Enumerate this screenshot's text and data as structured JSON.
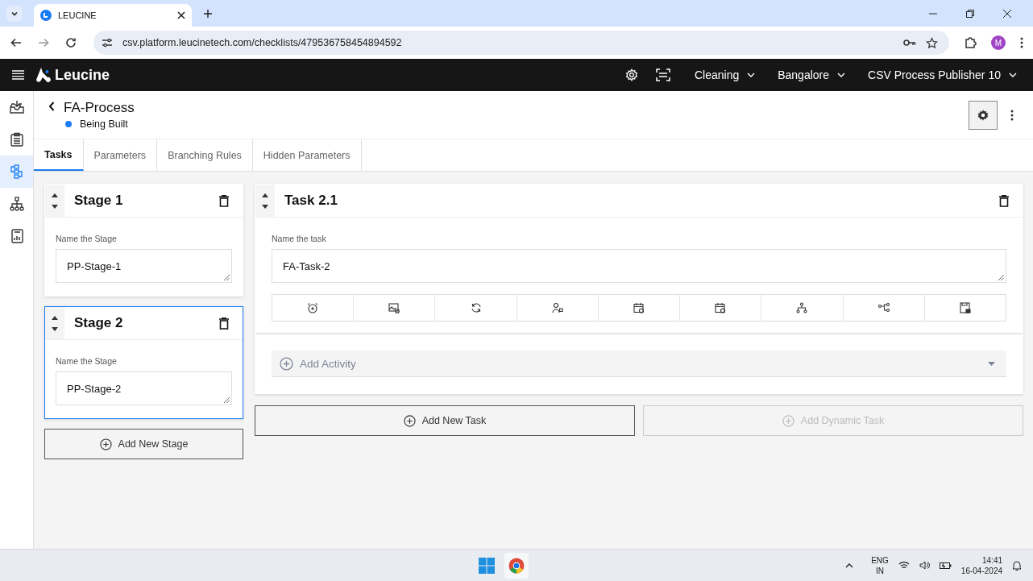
{
  "browser": {
    "tab_title": "LEUCINE",
    "url": "csv.platform.leucinetech.com/checklists/479536758454894592",
    "profile_initial": "M"
  },
  "header": {
    "brand": "Leucine",
    "selectors": [
      "Cleaning",
      "Bangalore",
      "CSV Process Publisher 10"
    ]
  },
  "sidebar": {
    "items": [
      {
        "selected": false
      },
      {
        "selected": false
      },
      {
        "selected": true
      },
      {
        "selected": false
      },
      {
        "selected": false
      }
    ]
  },
  "page": {
    "title": "FA-Process",
    "status": "Being Built"
  },
  "tabs": [
    {
      "label": "Tasks",
      "selected": true
    },
    {
      "label": "Parameters",
      "selected": false
    },
    {
      "label": "Branching Rules",
      "selected": false
    },
    {
      "label": "Hidden Parameters",
      "selected": false
    }
  ],
  "stages": [
    {
      "title": "Stage 1",
      "field_label": "Name the Stage",
      "value": "PP-Stage-1",
      "selected": false
    },
    {
      "title": "Stage 2",
      "field_label": "Name the Stage",
      "value": "PP-Stage-2",
      "selected": true
    }
  ],
  "add_stage": "Add New Stage",
  "task": {
    "title": "Task 2.1",
    "field_label": "Name the task",
    "value": "FA-Task-2",
    "add_activity": "Add Activity"
  },
  "task_buttons": [
    {
      "label": "Add New Task",
      "disabled": false
    },
    {
      "label": "Add Dynamic Task",
      "disabled": true
    }
  ],
  "taskbar": {
    "language": "ENG",
    "region": "IN",
    "time": "14:41",
    "date": "16-04-2024"
  }
}
